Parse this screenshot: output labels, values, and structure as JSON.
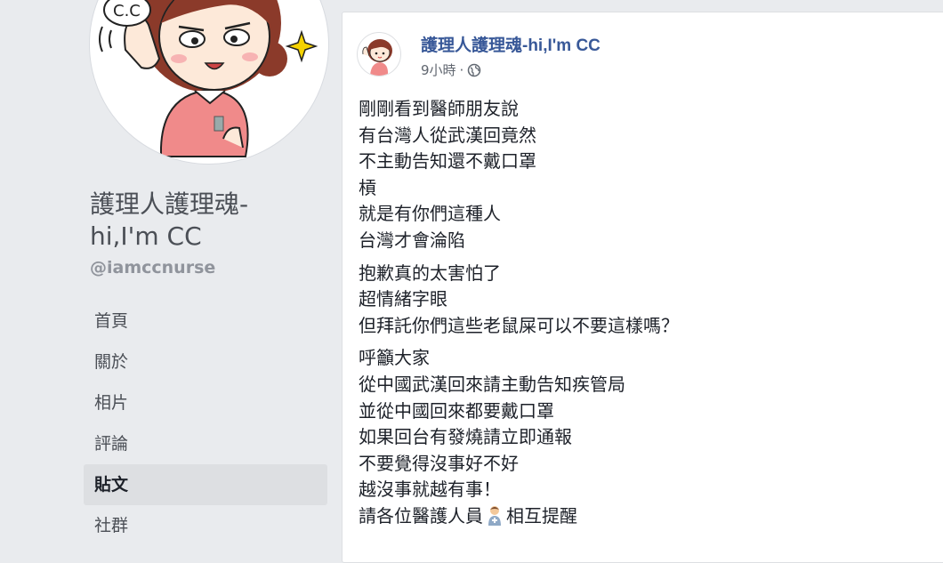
{
  "page": {
    "name": "護理人護理魂-hi,I'm CC",
    "name_line1": "護理人護理魂-",
    "name_line2": "hi,I'm CC",
    "handle": "@iamccnurse",
    "avatar_caption": "C.C"
  },
  "nav": {
    "items": [
      {
        "label": "首頁",
        "active": false
      },
      {
        "label": "關於",
        "active": false
      },
      {
        "label": "相片",
        "active": false
      },
      {
        "label": "評論",
        "active": false
      },
      {
        "label": "貼文",
        "active": true
      },
      {
        "label": "社群",
        "active": false
      }
    ]
  },
  "post": {
    "author": "護理人護理魂-hi,I'm CC",
    "timestamp": "9小時",
    "separator": "·",
    "privacy_icon": "globe-icon",
    "paragraphs": [
      [
        "剛剛看到醫師朋友說",
        "有台灣人從武漢回竟然",
        "不主動告知還不戴口罩",
        "槓",
        "就是有你們這種人",
        "台灣才會淪陷"
      ],
      [
        "抱歉真的太害怕了",
        "超情緒字眼",
        "但拜託你們這些老鼠屎可以不要這樣嗎？"
      ],
      [
        "呼籲大家",
        "從中國武漢回來請主動告知疾管局",
        "並從中國回來都要戴口罩",
        "如果回台有發燒請立即通報",
        "不要覺得沒事好不好",
        "越沒事就越有事！"
      ]
    ],
    "last_line_before": "請各位醫護人員",
    "last_line_emoji": "health-worker-emoji",
    "last_line_after": "相互提醒"
  },
  "colors": {
    "background": "#e9ebee",
    "card": "#ffffff",
    "link": "#385898",
    "text": "#1d2129",
    "muted": "#90949c",
    "nav_active_bg": "#dddfe2",
    "avatar_shirt": "#f08a8a",
    "avatar_hair": "#8b3a2a"
  }
}
